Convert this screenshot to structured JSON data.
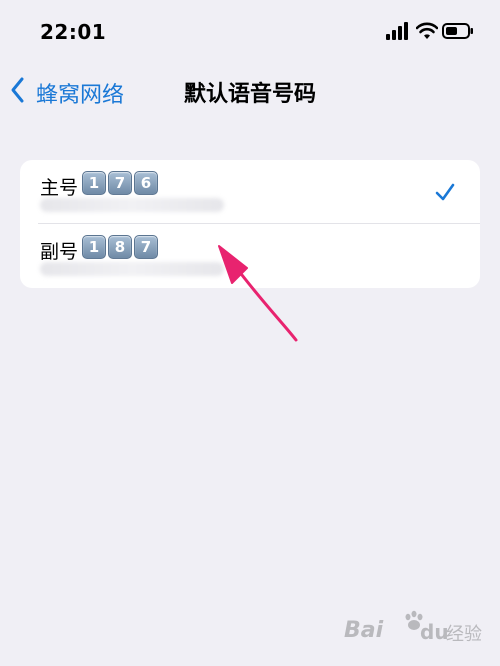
{
  "status_bar": {
    "time": "22:01",
    "icons": [
      "cellular-signal-icon",
      "wifi-icon",
      "battery-icon"
    ]
  },
  "nav": {
    "back_label": "蜂窝网络",
    "title": "默认语音号码"
  },
  "lines": [
    {
      "label": "主号",
      "number_digits": [
        "1",
        "7",
        "6"
      ],
      "selected": true
    },
    {
      "label": "副号",
      "number_digits": [
        "1",
        "8",
        "7"
      ],
      "selected": false
    }
  ],
  "watermark": {
    "bai": "Bai",
    "du": "du",
    "jingyan": "经验"
  },
  "colors": {
    "accent": "#1a78d6",
    "background": "#f0eff5",
    "annotation_arrow": "#e8236f"
  }
}
